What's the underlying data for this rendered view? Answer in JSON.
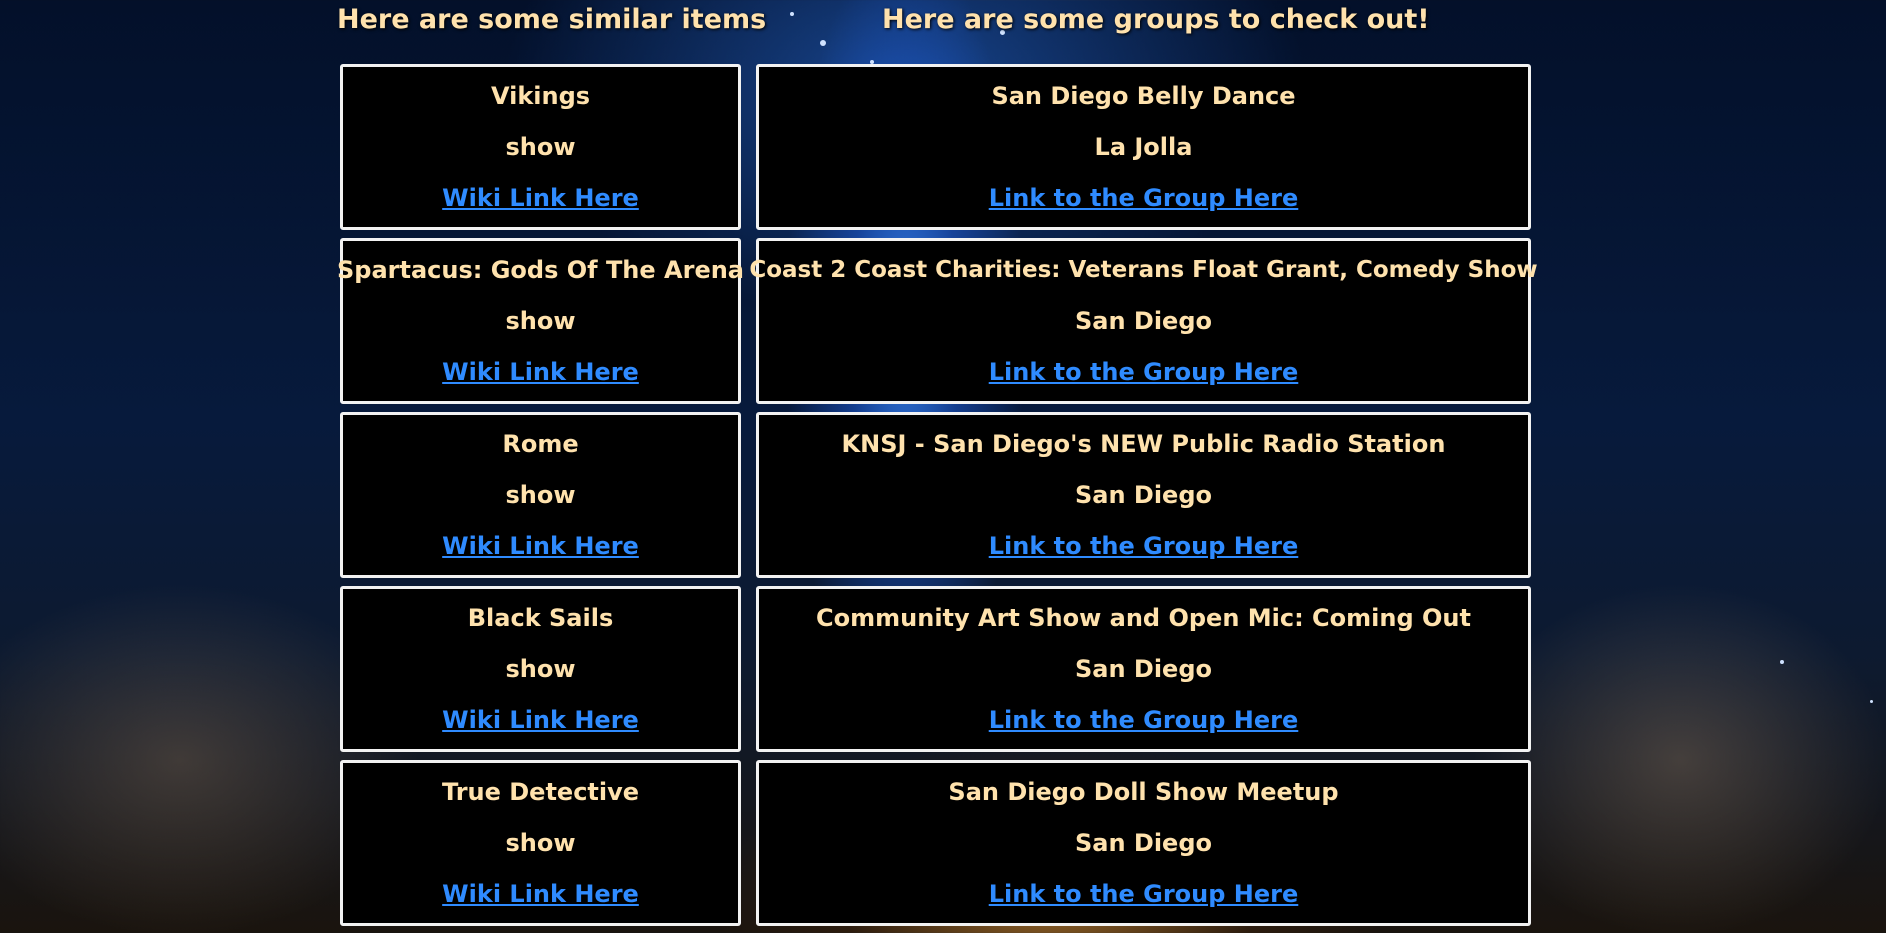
{
  "headings": {
    "items": "Here are some similar items",
    "groups": "Here are some groups to check out!"
  },
  "items": [
    {
      "title": "Vikings",
      "type": "show",
      "link": "Wiki Link Here"
    },
    {
      "title": "Spartacus: Gods Of The Arena",
      "type": "show",
      "link": "Wiki Link Here"
    },
    {
      "title": "Rome",
      "type": "show",
      "link": "Wiki Link Here"
    },
    {
      "title": "Black Sails",
      "type": "show",
      "link": "Wiki Link Here"
    },
    {
      "title": "True Detective",
      "type": "show",
      "link": "Wiki Link Here"
    }
  ],
  "groups": [
    {
      "name": "San Diego Belly Dance",
      "location": "La Jolla",
      "link": "Link to the Group Here"
    },
    {
      "name": "Coast 2 Coast Charities: Veterans Float Grant, Comedy Show",
      "location": "San Diego",
      "link": "Link to the Group Here"
    },
    {
      "name": "KNSJ - San Diego's NEW Public Radio Station",
      "location": "San Diego",
      "link": "Link to the Group Here"
    },
    {
      "name": "Community Art Show and Open Mic: Coming Out",
      "location": "San Diego",
      "link": "Link to the Group Here"
    },
    {
      "name": "San Diego Doll Show Meetup",
      "location": "San Diego",
      "link": "Link to the Group Here"
    }
  ],
  "colors": {
    "heading_text": "#ffe2ad",
    "card_bg": "#000000",
    "card_border": "#f2f2f2",
    "link": "#2f8bff"
  }
}
